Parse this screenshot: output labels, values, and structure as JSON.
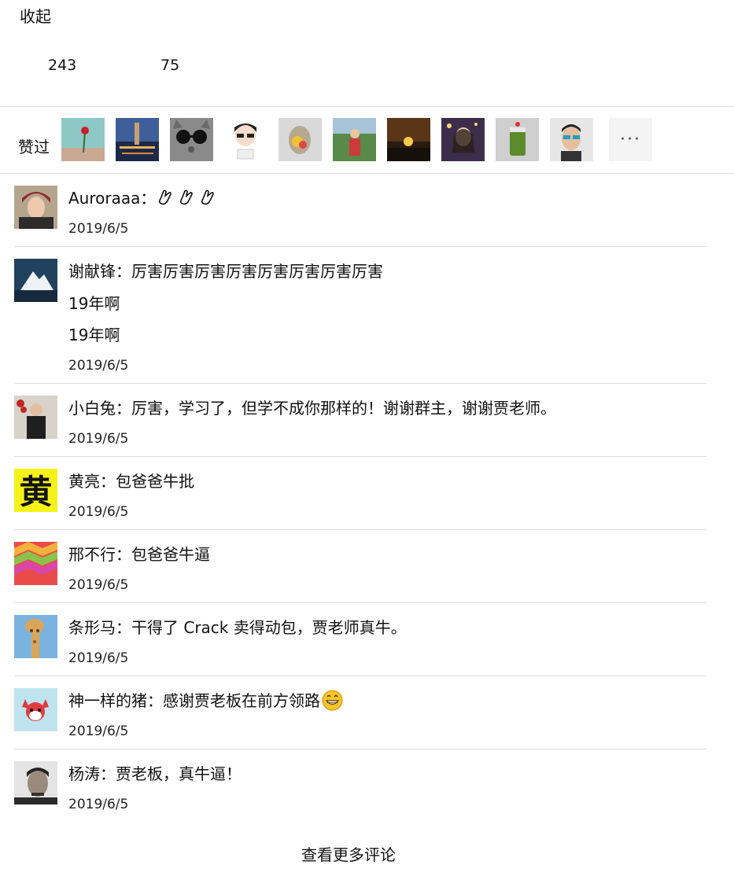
{
  "header": {
    "collapse_label": "收起",
    "stat_a": "243",
    "stat_b": "75"
  },
  "likes": {
    "label": "赞过",
    "avatars": [
      "rose",
      "city-night",
      "cat-sunglasses",
      "cartoon-boy",
      "statue-flowers",
      "man-garden",
      "sunset",
      "woman-lights",
      "green-drink",
      "man-sunglasses"
    ],
    "more_label": "···"
  },
  "comments": [
    {
      "author": "Auroraaa",
      "text": "",
      "emoji": [
        "clap-icon",
        "clap-icon",
        "clap-icon"
      ],
      "date": "2019/6/5"
    },
    {
      "author": "谢献锋",
      "text": "厉害厉害厉害厉害厉害厉害厉害厉害",
      "extra_lines": [
        "19年啊",
        "19年啊"
      ],
      "date": "2019/6/5"
    },
    {
      "author": "小白兔",
      "text": "厉害，学习了，但学不成你那样的！谢谢群主，谢谢贾老师。",
      "date": "2019/6/5"
    },
    {
      "author": "黄亮",
      "text": "包爸爸牛批",
      "date": "2019/6/5"
    },
    {
      "author": "邢不行",
      "text": "包爸爸牛逼",
      "date": "2019/6/5"
    },
    {
      "author": "条形马",
      "text": "干得了 Crack 卖得动包，贾老师真牛。",
      "date": "2019/6/5"
    },
    {
      "author": "神一样的猪",
      "text": "感谢贾老板在前方领路",
      "emoji": [
        "grin-icon"
      ],
      "date": "2019/6/5"
    },
    {
      "author": "杨涛",
      "text": "贾老板，真牛逼！",
      "date": "2019/6/5"
    }
  ],
  "avatar_badge_char": "黄",
  "separator": "：",
  "footer": {
    "view_more_label": "查看更多评论"
  }
}
